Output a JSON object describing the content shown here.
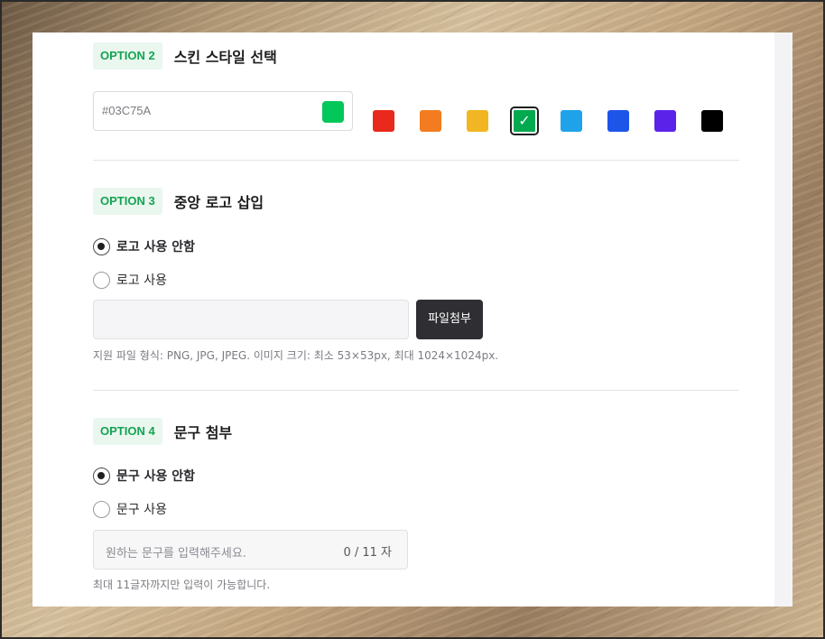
{
  "option2": {
    "badge": "OPTION 2",
    "title": "스킨 스타일 선택",
    "hex_value": "#03C75A",
    "preview_color": "#03C75A",
    "swatches": [
      {
        "color": "#E8291C"
      },
      {
        "color": "#F27C1F"
      },
      {
        "color": "#F1B622"
      },
      {
        "color": "#03A94E",
        "selected": true
      },
      {
        "color": "#1EA3EA"
      },
      {
        "color": "#1D55E8"
      },
      {
        "color": "#5B23EA"
      },
      {
        "color": "#000000"
      }
    ]
  },
  "option3": {
    "badge": "OPTION 3",
    "title": "중앙 로고 삽입",
    "radio_none": "로고 사용 안함",
    "radio_use": "로고 사용",
    "file_button": "파일첨부",
    "help": "지원 파일 형식: PNG, JPG, JPEG. 이미지 크기: 최소 53×53px, 최대 1024×1024px."
  },
  "option4": {
    "badge": "OPTION 4",
    "title": "문구 첨부",
    "radio_none": "문구 사용 안함",
    "radio_use": "문구 사용",
    "placeholder": "원하는 문구를 입력해주세요.",
    "counter": "0 / 11 자",
    "help": "최대 11글자까지만 입력이 가능합니다."
  },
  "colors": {
    "badge_bg": "#E9F7EF",
    "badge_text": "#15A352",
    "file_button_bg": "#2F2F33"
  }
}
